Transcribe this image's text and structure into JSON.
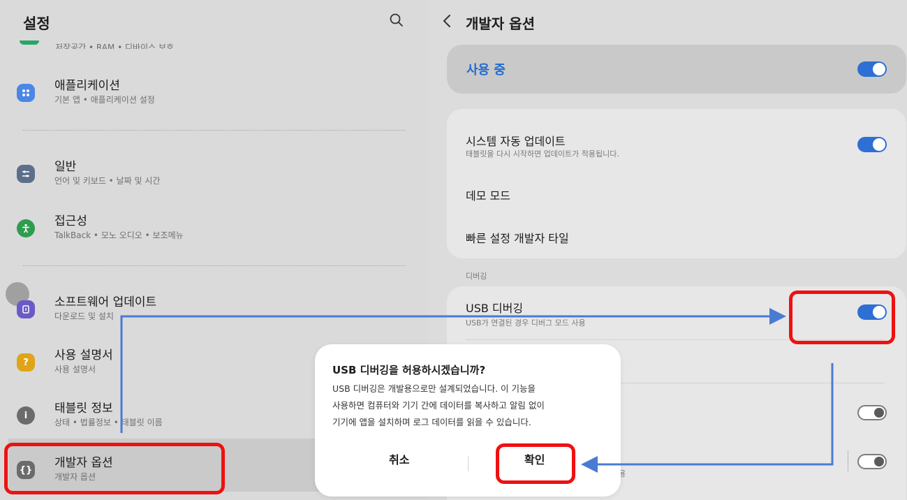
{
  "left_panel": {
    "title": "설정",
    "cut_off_subtitle": "저장공간 • RAM • 디바이스 보호",
    "items": [
      {
        "title": "애플리케이션",
        "subtitle": "기본 앱 • 애플리케이션 설정",
        "icon": "apps-icon",
        "color": "#4b86e6"
      },
      {
        "title": "일반",
        "subtitle": "언어 및 키보드 • 날짜 및 시간",
        "icon": "sliders-icon",
        "color": "#5c6f8a"
      },
      {
        "title": "접근성",
        "subtitle": "TalkBack • 모노 오디오 • 보조메뉴",
        "icon": "accessibility-icon",
        "color": "#2f9c4e"
      },
      {
        "title": "소프트웨어 업데이트",
        "subtitle": "다운로드 및 설치",
        "icon": "update-icon",
        "color": "#6a5ac8"
      },
      {
        "title": "사용 설명서",
        "subtitle": "사용 설명서",
        "icon": "manual-icon",
        "color": "#e0a419"
      },
      {
        "title": "태블릿 정보",
        "subtitle": "상태 • 법률정보 • 태블릿 이름",
        "icon": "info-icon",
        "color": "#6b6b6b"
      },
      {
        "title": "개발자 옵션",
        "subtitle": "개발자 옵션",
        "icon": "code-braces-icon",
        "color": "#6b6b6b"
      }
    ]
  },
  "right_panel": {
    "title": "개발자 옵션",
    "in_use_label": "사용 중",
    "in_use_toggle": "on",
    "items": {
      "auto_update": {
        "title": "시스템 자동 업데이트",
        "subtitle": "태블릿을 다시 시작하면 업데이트가 적용됩니다.",
        "toggle": "on"
      },
      "demo_mode": {
        "title": "데모 모드"
      },
      "quick_tiles": {
        "title": "빠른 설정 개발자 타일"
      }
    },
    "section_debugging": "디버깅",
    "usb_debugging": {
      "title": "USB 디버깅",
      "subtitle": "USB가 연결된 경우 디버그 모드 사용",
      "toggle": "on"
    },
    "lower_toggles": [
      "off",
      "off"
    ],
    "partial_text": "용"
  },
  "dialog": {
    "title": "USB 디버깅을 허용하시겠습니까?",
    "body_lines": [
      "USB 디버깅은 개발용으로만 설계되었습니다. 이 기능을",
      "사용하면 컴퓨터와 기기 간에 데이터를 복사하고 알림 없이",
      "기기에 앱을 설치하며 로그 데이터를 읽을 수 있습니다."
    ],
    "cancel_label": "취소",
    "confirm_label": "확인"
  },
  "colors": {
    "accent_blue": "#2d6fd4",
    "annotation_red": "#ee1111",
    "annotation_blue": "#4a7bd3"
  }
}
